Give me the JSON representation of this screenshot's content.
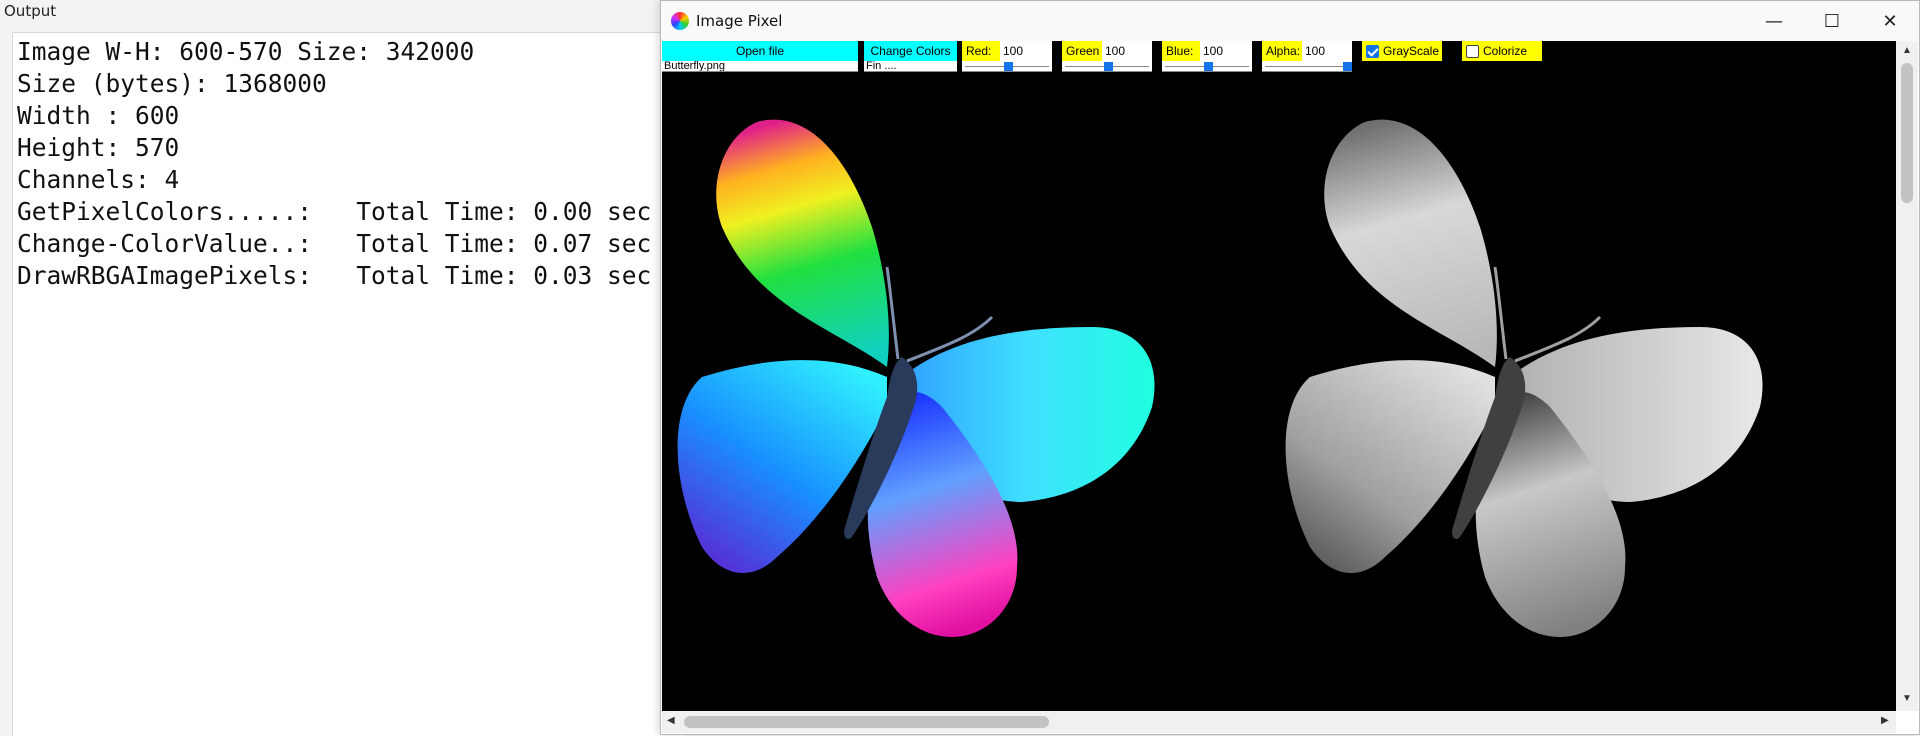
{
  "output": {
    "title": "Output",
    "lines": [
      "Image W-H: 600-570 Size: 342000",
      "Size (bytes): 1368000",
      "Width : 600",
      "Height: 570",
      "Channels: 4",
      "GetPixelColors.....:   Total Time: 0.00 sec",
      "Change-ColorValue..:   Total Time: 0.07 sec",
      "DrawRBGAImagePixels:   Total Time: 0.03 sec"
    ]
  },
  "window": {
    "title": "Image Pixel",
    "minimize": "—",
    "maximize": "☐",
    "close": "✕"
  },
  "toolbar": {
    "open_file": "Open file",
    "file_name": "Butterfly.png",
    "change_colors": "Change Colors",
    "status": "Fin ....",
    "red_label": "Red:",
    "red_value": "100",
    "green_label": "Green",
    "green_value": "100",
    "blue_label": "Blue:",
    "blue_value": "100",
    "alpha_label": "Alpha:",
    "alpha_value": "100",
    "grayscale_label": "GrayScale",
    "colorize_label": "Colorize"
  },
  "controls": {
    "red_slider_fraction": 0.5,
    "green_slider_fraction": 0.5,
    "blue_slider_fraction": 0.5,
    "alpha_slider_fraction": 1.0,
    "grayscale_checked": true,
    "colorize_checked": false
  },
  "icons": {
    "app": "color-wheel-icon",
    "scroll_up": "▲",
    "scroll_down": "▼",
    "scroll_left": "◀",
    "scroll_right": "▶"
  },
  "colors": {
    "toolbar_cyan": "#00ffff",
    "toolbar_yellow": "#ffff00",
    "slider_accent": "#1473e6",
    "canvas_bg": "#000000"
  }
}
